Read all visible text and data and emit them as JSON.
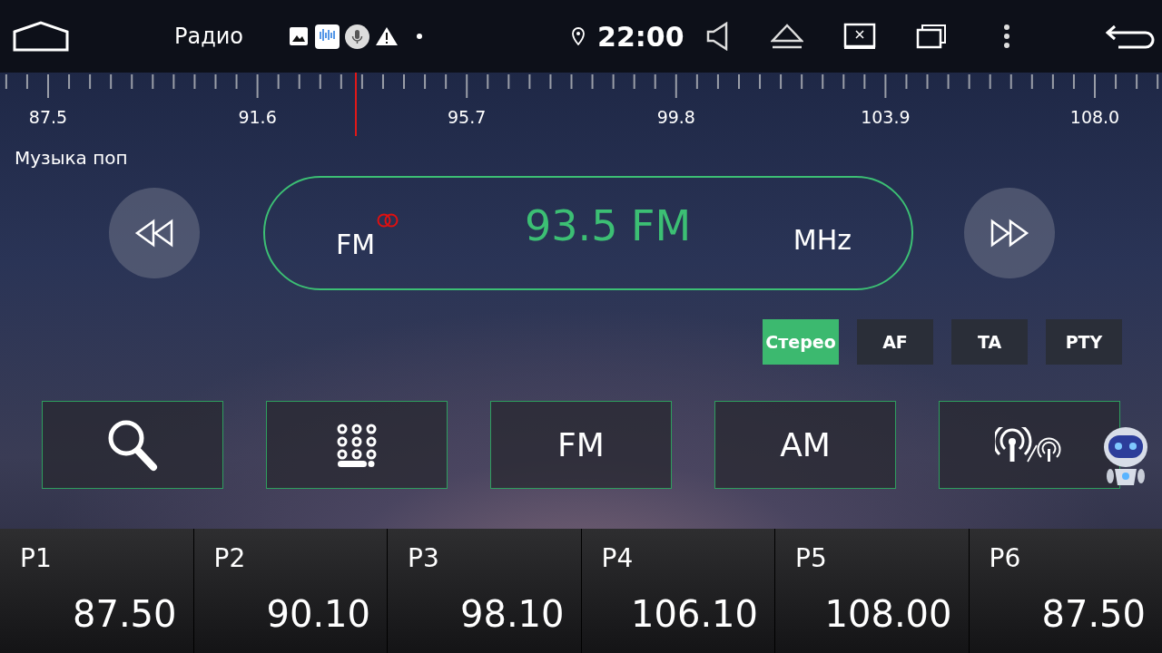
{
  "status_bar": {
    "title": "Радио",
    "time": "22:00"
  },
  "scale": {
    "labels": [
      "87.5",
      "91.6",
      "95.7",
      "99.8",
      "103.9",
      "108.0"
    ],
    "level": 0.293
  },
  "station": {
    "name": "Музыка поп",
    "band": "FM",
    "frequency": "93.5 FM",
    "unit": "MHz"
  },
  "rds_buttons": [
    {
      "label": "Стерео",
      "selected": true
    },
    {
      "label": "AF",
      "selected": false
    },
    {
      "label": "TA",
      "selected": false
    },
    {
      "label": "PTY",
      "selected": false
    }
  ],
  "controls": [
    {
      "kind": "search"
    },
    {
      "kind": "keypad"
    },
    {
      "kind": "text",
      "label": "FM"
    },
    {
      "kind": "text",
      "label": "AM"
    },
    {
      "kind": "antenna"
    }
  ],
  "presets": [
    {
      "label": "P1",
      "frequency": "87.50"
    },
    {
      "label": "P2",
      "frequency": "90.10"
    },
    {
      "label": "P3",
      "frequency": "98.10"
    },
    {
      "label": "P4",
      "frequency": "106.10"
    },
    {
      "label": "P5",
      "frequency": "108.00"
    },
    {
      "label": "P6",
      "frequency": "87.50"
    }
  ]
}
